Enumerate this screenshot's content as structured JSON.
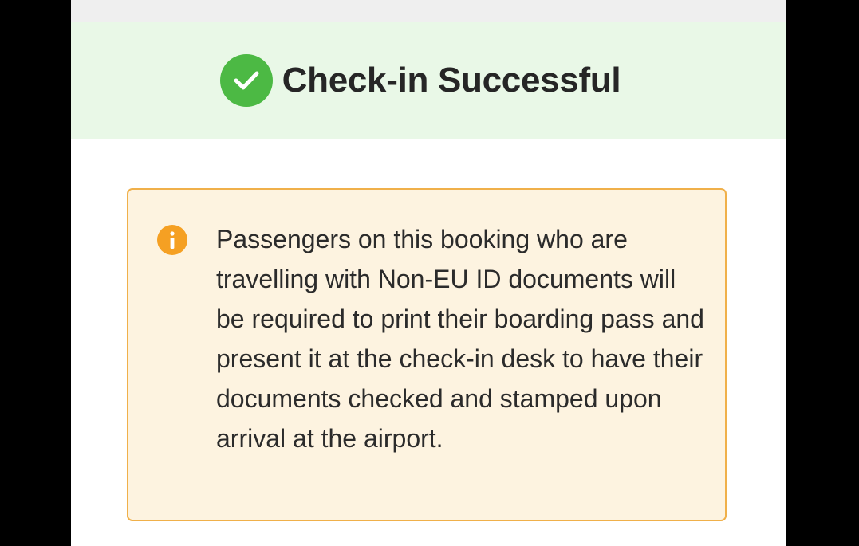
{
  "banner": {
    "title": "Check-in Successful",
    "icon": "check-circle-icon",
    "background_color": "#e9f8e7",
    "icon_color": "#4cb944"
  },
  "notice": {
    "icon": "info-icon",
    "icon_color": "#f5a023",
    "background_color": "#fdf3e0",
    "border_color": "#f0b04a",
    "message": "Passengers on this booking who are travelling with Non-EU ID documents will be required to print their boarding pass and present it at the check-in desk to have their documents checked and stamped upon arrival at the airport."
  }
}
